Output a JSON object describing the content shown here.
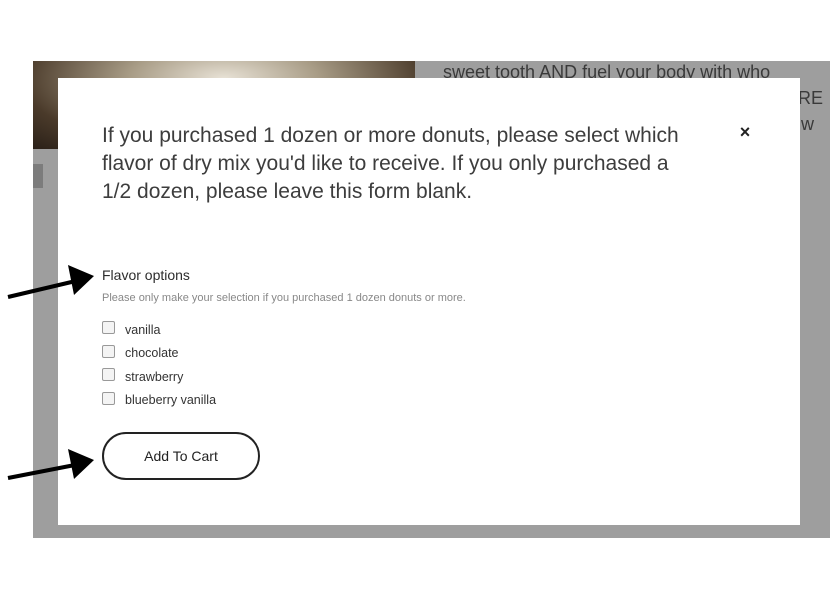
{
  "background": {
    "text_lines": [
      "sweet tooth AND fuel your body with who",
      "RE",
      "w"
    ]
  },
  "modal": {
    "title": "If you purchased 1 dozen or more donuts, please select which flavor of dry mix you'd like to receive. If you only purchased a 1/2 dozen, please leave this form blank.",
    "close_glyph": "×",
    "close_icon": "close-icon",
    "field_label": "Flavor options",
    "field_help": "Please only make your selection if you purchased 1 dozen donuts or more.",
    "options": [
      {
        "label": "vanilla",
        "checked": false
      },
      {
        "label": "chocolate",
        "checked": false
      },
      {
        "label": "strawberry",
        "checked": false
      },
      {
        "label": "blueberry vanilla",
        "checked": false
      }
    ],
    "submit_label": "Add To Cart"
  }
}
